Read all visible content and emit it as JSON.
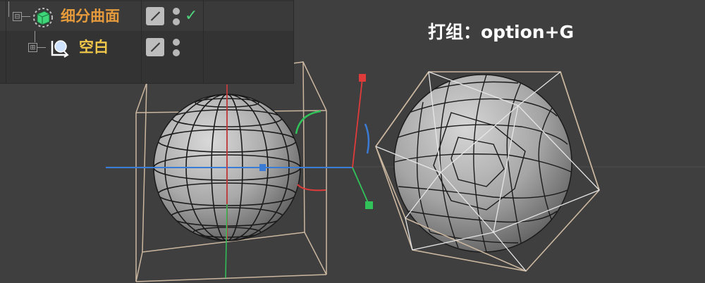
{
  "object_manager": {
    "objects": [
      {
        "name": "细分曲面",
        "label_color": "#e59a3c",
        "icon": "subdivision-surface-icon",
        "icon_color": "#3fd67a",
        "tree_toggle": "⊟",
        "enabled": true
      },
      {
        "name": "空白",
        "label_color": "#f2c84b",
        "icon": "null-object-icon",
        "icon_color": "#cfe3ff",
        "tree_toggle": "⊞",
        "enabled": false
      }
    ],
    "check_mark": "✓",
    "check_color": "#4fd07a"
  },
  "viewport": {
    "caption": "打组：option+G",
    "background_color": "#3f3f3f",
    "axis_colors": {
      "x": "#3a7bd5",
      "y": "#e03b3b",
      "z": "#32c25a"
    },
    "bounding_box_color": "#cbb7a0",
    "objects": [
      "sphere-with-bounding-box",
      "subdivided-sphere-with-cage"
    ]
  }
}
